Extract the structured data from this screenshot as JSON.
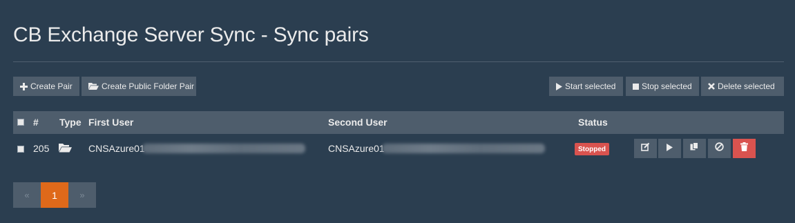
{
  "page": {
    "title": "CB Exchange Server Sync - Sync pairs"
  },
  "toolbar": {
    "create_pair": "Create Pair",
    "create_public_folder_pair": "Create Public Folder Pair",
    "start_selected": "Start selected",
    "stop_selected": "Stop selected",
    "delete_selected": "Delete selected"
  },
  "table": {
    "headers": {
      "number": "#",
      "type": "Type",
      "first_user": "First User",
      "second_user": "Second User",
      "status": "Status"
    },
    "rows": [
      {
        "id": "205",
        "type_icon": "folder-open-icon",
        "first_user": "CNSAzure01",
        "second_user": "CNSAzure01",
        "status": "Stopped"
      }
    ]
  },
  "pagination": {
    "prev": "«",
    "current": "1",
    "next": "»"
  },
  "colors": {
    "background": "#2b3e50",
    "panel": "#4e5d6c",
    "accent": "#df691a",
    "danger": "#d9534f"
  }
}
